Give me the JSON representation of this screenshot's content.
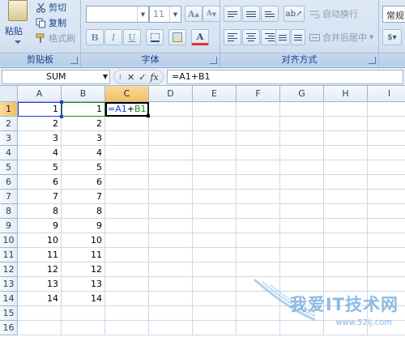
{
  "ribbon": {
    "clipboard": {
      "paste_label": "粘贴",
      "cut_label": "剪切",
      "copy_label": "复制",
      "format_painter_label": "格式刷",
      "group_label": "剪贴板"
    },
    "font": {
      "font_name": "",
      "font_size": "11",
      "bold_label": "B",
      "italic_label": "I",
      "underline_label": "U",
      "font_color_label": "A",
      "grow_label": "A",
      "shrink_label": "A",
      "group_label": "字体"
    },
    "alignment": {
      "wrap_text_label": "自动换行",
      "merge_center_label": "合并后居中",
      "group_label": "对齐方式"
    },
    "number": {
      "format_label": "常规"
    }
  },
  "formula_bar": {
    "name_box": "SUM",
    "cancel_symbol": "✕",
    "enter_symbol": "✓",
    "fx_symbol": "fx",
    "formula": "=A1+B1"
  },
  "sheet": {
    "columns": [
      "A",
      "B",
      "C",
      "D",
      "E",
      "F",
      "G",
      "H",
      "I"
    ],
    "rows": [
      "1",
      "2",
      "3",
      "4",
      "5",
      "6",
      "7",
      "8",
      "9",
      "10",
      "11",
      "12",
      "13",
      "14",
      "15",
      "16"
    ],
    "col_a": [
      "1",
      "2",
      "3",
      "4",
      "5",
      "6",
      "7",
      "8",
      "9",
      "10",
      "11",
      "12",
      "13",
      "14"
    ],
    "col_b": [
      "1",
      "2",
      "3",
      "4",
      "5",
      "6",
      "7",
      "8",
      "9",
      "10",
      "11",
      "12",
      "13",
      "14"
    ],
    "editing_cell": {
      "ref_a": "=A1",
      "plus": "+",
      "ref_b": "B1"
    }
  },
  "watermark": {
    "text": "我爱IT技术网",
    "url": "www.52ij.com"
  },
  "colors": {
    "ribbon_bg": "#d6e3f2",
    "header_active": "#f1c15f",
    "ref_a": "#1f3dd6",
    "ref_b": "#1a8b1a"
  }
}
